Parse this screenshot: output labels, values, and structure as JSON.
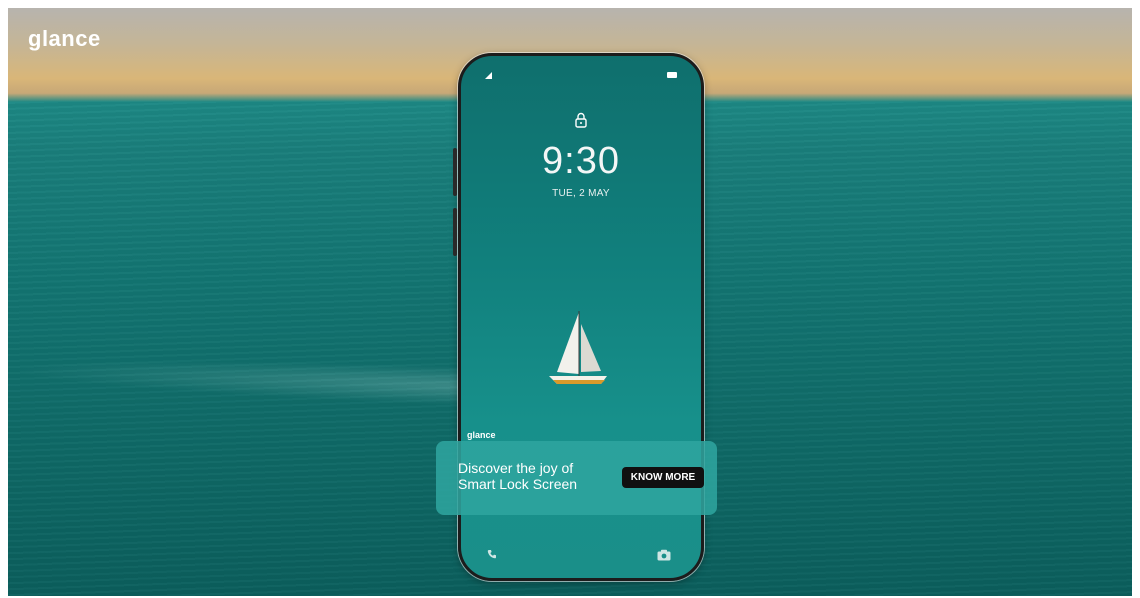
{
  "brand": {
    "logo_text": "glance"
  },
  "lock_screen": {
    "time": "9:30",
    "date": "TUE, 2 MAY",
    "logo_text": "glance"
  },
  "banner": {
    "line1": "Discover the joy of",
    "line2": "Smart Lock Screen",
    "button_label": "KNOW MORE"
  },
  "icons": {
    "lock": "lock-icon",
    "phone": "phone-icon",
    "camera": "camera-icon",
    "signal": "signal-icon",
    "battery": "battery-icon"
  },
  "colors": {
    "sea": "#137673",
    "banner": "#2ea5a0",
    "button": "#101010"
  }
}
